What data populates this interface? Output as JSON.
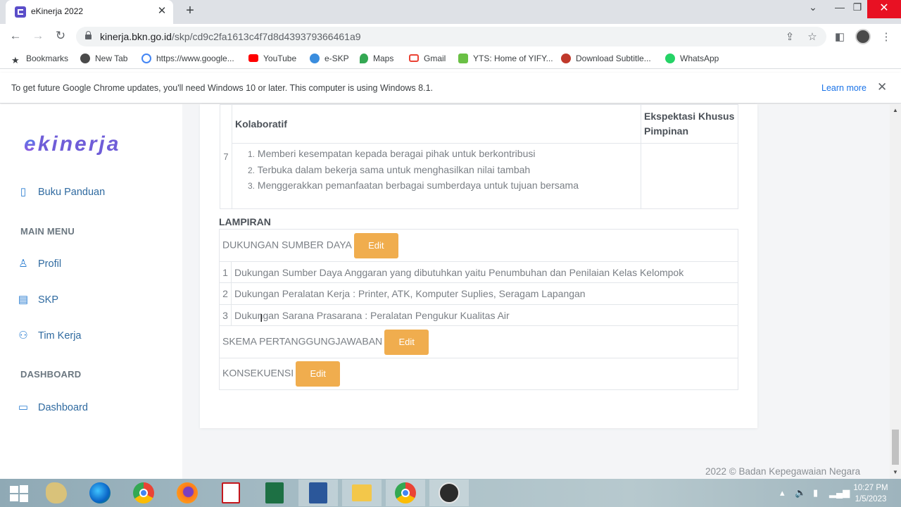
{
  "browser": {
    "tab_title": "eKinerja 2022",
    "url_host": "kinerja.bkn.go.id",
    "url_path": "/skp/cd9c2fa1613c4f7d8d439379366461a9",
    "bookmarks": [
      "Bookmarks",
      "New Tab",
      "https://www.google...",
      "YouTube",
      "e-SKP",
      "Maps",
      "Gmail",
      "YTS: Home of YIFY...",
      "Download Subtitle...",
      "WhatsApp"
    ],
    "infobar_text": "To get future Google Chrome updates, you'll need Windows 10 or later. This computer is using Windows 8.1.",
    "infobar_link": "Learn more"
  },
  "sidebar": {
    "logo": {
      "first": "e",
      "rest": "kinerja"
    },
    "top_item": "Buku Panduan",
    "sections": [
      {
        "title": "MAIN MENU",
        "items": [
          "Profil",
          "SKP",
          "Tim Kerja"
        ]
      },
      {
        "title": "DASHBOARD",
        "items": [
          "Dashboard"
        ]
      }
    ]
  },
  "main": {
    "behavior_row": {
      "number": "7",
      "title": "Kolaboratif",
      "expectation_header": "Ekspektasi Khusus Pimpinan",
      "items": [
        "Memberi kesempatan kepada beragai pihak untuk berkontribusi",
        "Terbuka dalam bekerja sama untuk menghasilkan nilai tambah",
        "Menggerakkan pemanfaatan berbagai sumberdaya untuk tujuan bersama"
      ]
    },
    "lampiran": {
      "title": "LAMPIRAN",
      "dukungan_label": "DUKUNGAN SUMBER DAYA",
      "dukungan_items": [
        {
          "no": "1",
          "text": "Dukungan Sumber Daya Anggaran yang dibutuhkan yaitu Penumbuhan dan Penilaian Kelas Kelompok"
        },
        {
          "no": "2",
          "text": "Dukungan Peralatan Kerja : Printer, ATK, Komputer Suplies, Seragam Lapangan"
        },
        {
          "no": "3",
          "text": "Dukungan Sarana Prasarana : Peralatan Pengukur Kualitas Air"
        }
      ],
      "skema_label": "SKEMA PERTANGGUNGJAWABAN",
      "konsekuensi_label": "KONSEKUENSI",
      "edit_label": "Edit"
    }
  },
  "footer": "2022 © Badan Kepegawaian Negara",
  "taskbar": {
    "time": "10:27 PM",
    "date": "1/5/2023"
  },
  "colors": {
    "accent_orange": "#f0ad4e",
    "sidebar_blue": "#2a7dd1",
    "logo_purple": "#6f5dd8"
  }
}
